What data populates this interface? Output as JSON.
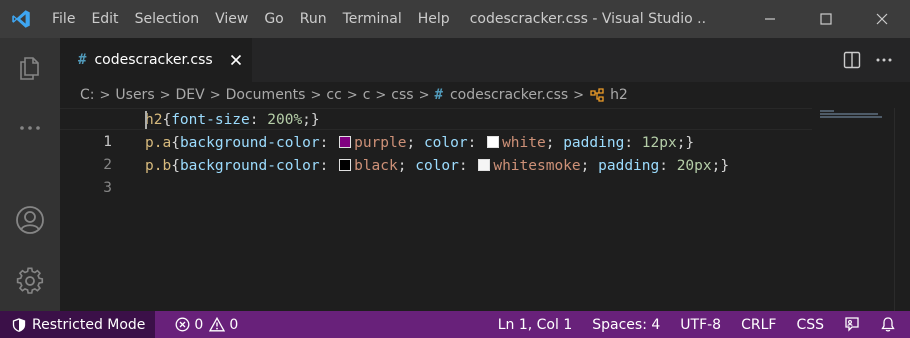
{
  "titlebar": {
    "menu": [
      "File",
      "Edit",
      "Selection",
      "View",
      "Go",
      "Run",
      "Terminal",
      "Help"
    ],
    "title": "codescracker.css - Visual Studio ..."
  },
  "tab": {
    "icon": "#",
    "label": "codescracker.css"
  },
  "breadcrumb": {
    "parts": [
      "C:",
      "Users",
      "DEV",
      "Documents",
      "cc",
      "c",
      "css"
    ],
    "file_icon": "#",
    "file": "codescracker.css",
    "symbol": "h2"
  },
  "editor": {
    "line_numbers": [
      "1",
      "2",
      "3"
    ],
    "line1": {
      "selector": "h2",
      "open": "{",
      "prop": "font-size",
      "colon": ": ",
      "value": "200%",
      "end": ";}"
    },
    "line2": {
      "selector": "p.a",
      "open": "{",
      "prop1": "background-color",
      "colon1": ": ",
      "value1": "purple",
      "semi1": "; ",
      "prop2": "color",
      "colon2": ": ",
      "value2": "white",
      "semi2": "; ",
      "prop3": "padding",
      "colon3": ": ",
      "value3": "12px",
      "end": ";}"
    },
    "line3": {
      "selector": "p.b",
      "open": "{",
      "prop1": "background-color",
      "colon1": ": ",
      "value1": "black",
      "semi1": "; ",
      "prop2": "color",
      "colon2": ": ",
      "value2": "whitesmoke",
      "semi2": "; ",
      "prop3": "padding",
      "colon3": ": ",
      "value3": "20px",
      "end": ";}"
    },
    "swatch_colors": {
      "purple": "#800080",
      "white": "#ffffff",
      "black": "#000000",
      "whitesmoke": "#f5f5f5"
    }
  },
  "statusbar": {
    "restricted_mode": "Restricted Mode",
    "errors": "0",
    "warnings": "0",
    "position": "Ln 1, Col 1",
    "spaces": "Spaces: 4",
    "encoding": "UTF-8",
    "eol": "CRLF",
    "language": "CSS",
    "color": "#68217a"
  },
  "icons": [
    "vscode-logo-icon",
    "explorer-icon",
    "more-icon",
    "account-icon",
    "settings-gear-icon",
    "split-editor-icon",
    "more-actions-icon",
    "close-icon",
    "shield-icon",
    "error-icon",
    "warning-icon",
    "feedback-icon",
    "bell-icon"
  ]
}
